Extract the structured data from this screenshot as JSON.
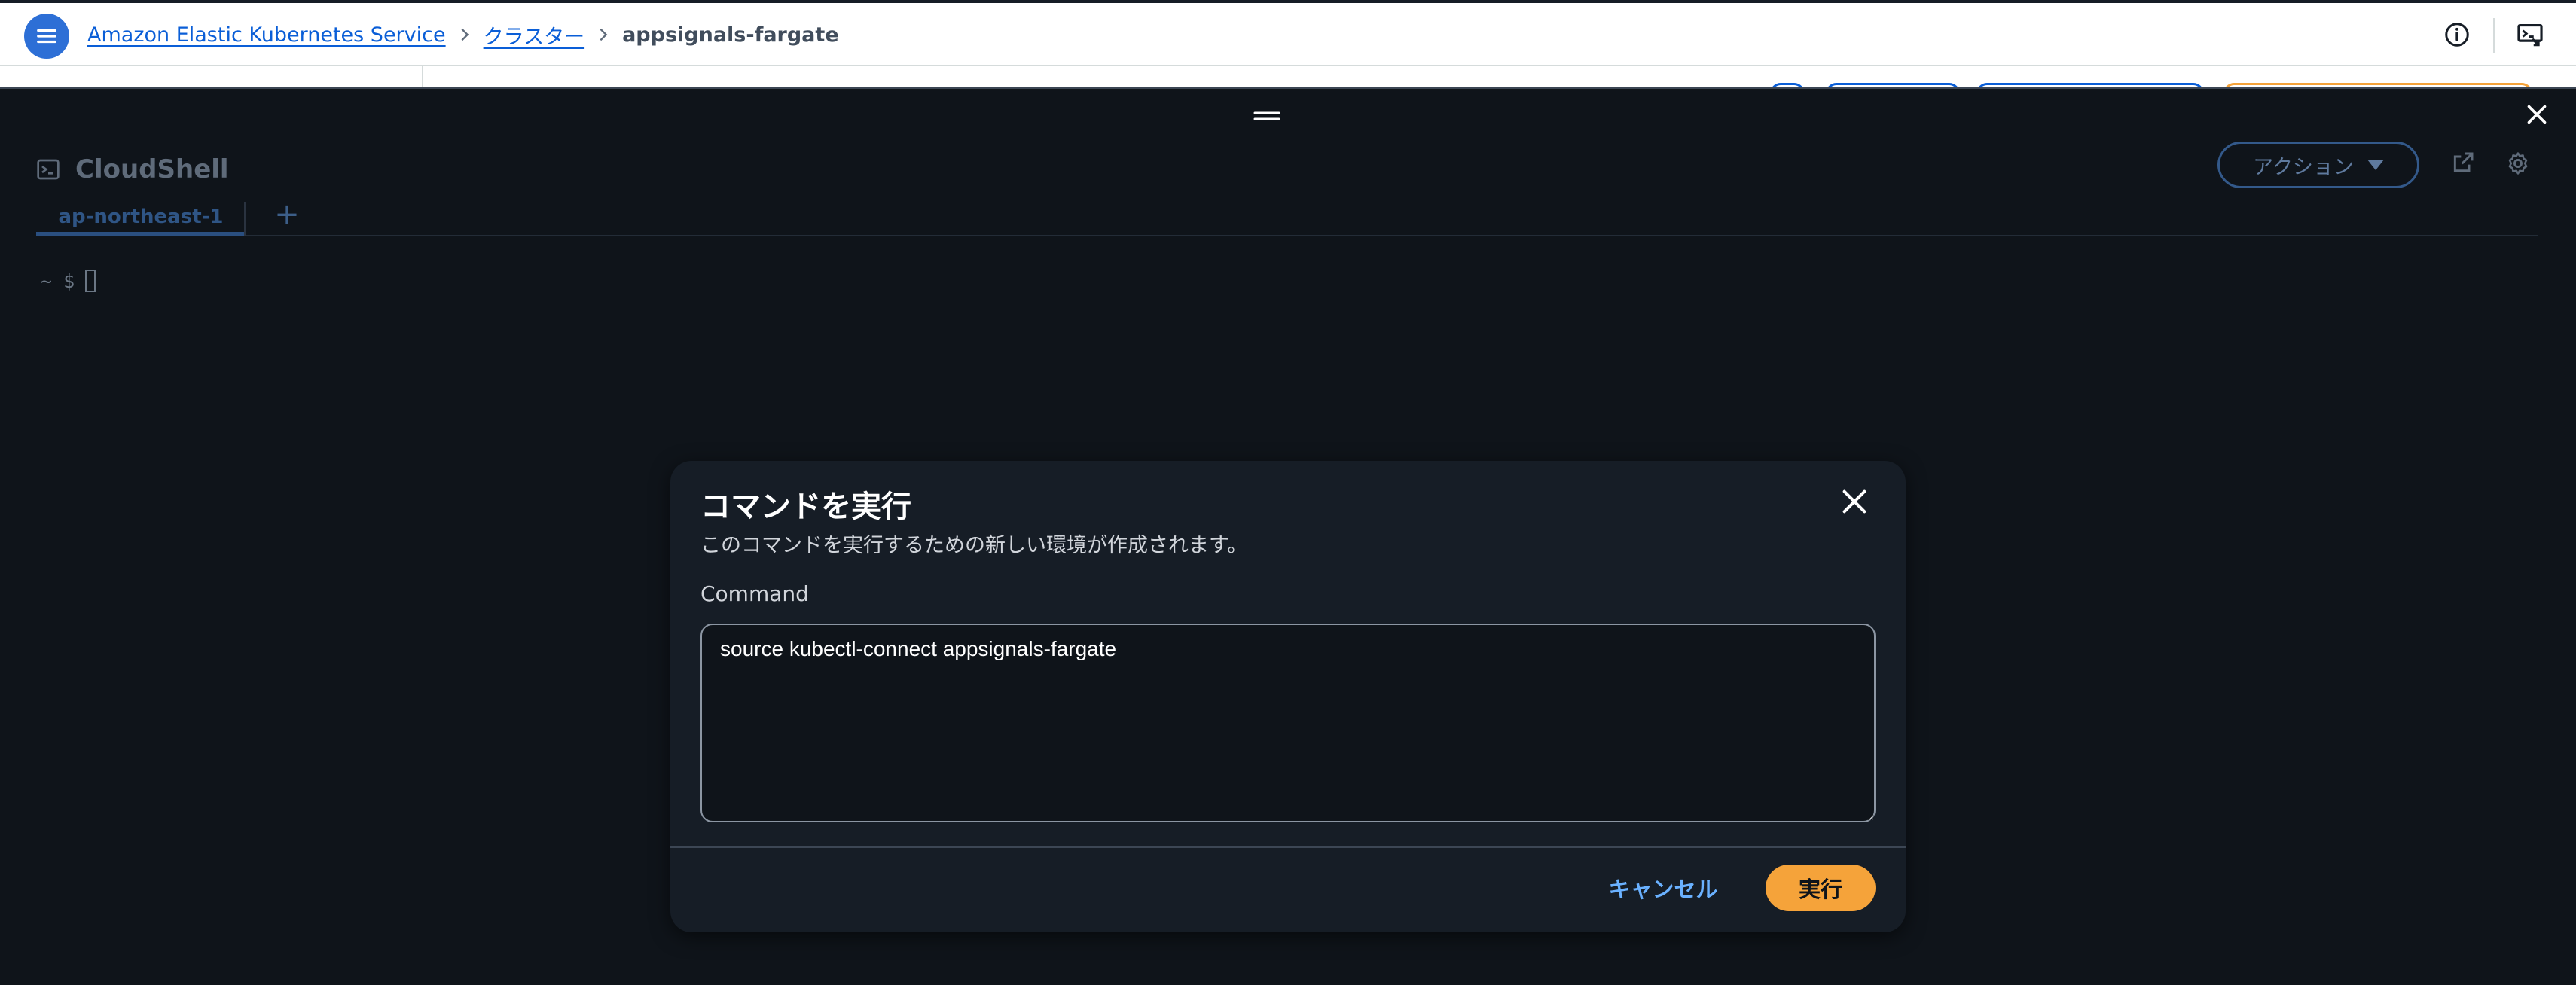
{
  "breadcrumb": {
    "items": [
      {
        "label": "Amazon Elastic Kubernetes Service"
      },
      {
        "label": "クラスター"
      },
      {
        "label": "appsignals-fargate"
      }
    ]
  },
  "cloudshell": {
    "title": "CloudShell",
    "actions_label": "アクション",
    "tabs": [
      {
        "label": "ap-northeast-1"
      }
    ],
    "add_tab_label": "+",
    "prompt": "~ $"
  },
  "modal": {
    "title": "コマンドを実行",
    "description": "このコマンドを実行するための新しい環境が作成されます。",
    "command_label": "Command",
    "command_value": "source kubectl-connect appsignals-fargate",
    "cancel_label": "キャンセル",
    "run_label": "実行"
  },
  "colors": {
    "primary_blue": "#2d6fd6",
    "link_blue": "#0a5ed7",
    "shell_bg": "#0f141a",
    "modal_bg": "#161d26",
    "run_orange": "#f5a33a",
    "cancel_text": "#6ab1ff"
  }
}
